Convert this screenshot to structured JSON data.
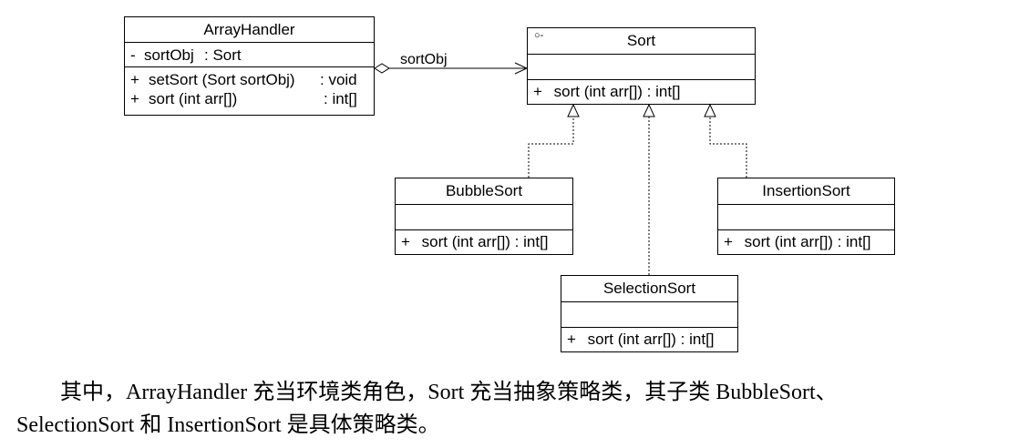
{
  "classes": {
    "array_handler": {
      "name": "ArrayHandler",
      "attributes": [
        {
          "vis": "-",
          "text": "sortObj",
          "type": ": Sort"
        }
      ],
      "operations": [
        {
          "vis": "+",
          "text": "setSort (Sort sortObj)",
          "type": ": void"
        },
        {
          "vis": "+",
          "text": "sort (int arr[])",
          "type": ": int[]"
        }
      ]
    },
    "sort": {
      "name": "Sort",
      "marker": "○-",
      "operations": [
        {
          "vis": "+",
          "text": "sort (int arr[]) : int[]"
        }
      ]
    },
    "bubble_sort": {
      "name": "BubbleSort",
      "operations": [
        {
          "vis": "+",
          "text": "sort (int arr[]) : int[]"
        }
      ]
    },
    "selection_sort": {
      "name": "SelectionSort",
      "operations": [
        {
          "vis": "+",
          "text": "sort (int arr[]) : int[]"
        }
      ]
    },
    "insertion_sort": {
      "name": "InsertionSort",
      "operations": [
        {
          "vis": "+",
          "text": "sort (int arr[]) : int[]"
        }
      ]
    }
  },
  "association_label": "sortObj",
  "caption": {
    "line1": "其中，ArrayHandler 充当环境类角色，Sort 充当抽象策略类，其子类 BubbleSort、",
    "line2": "SelectionSort 和 InsertionSort 是具体策略类。"
  }
}
